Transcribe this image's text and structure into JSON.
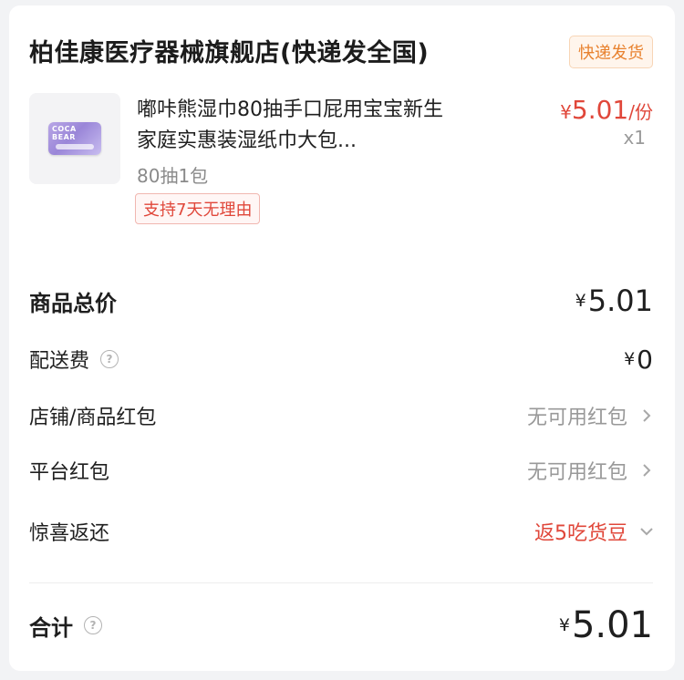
{
  "shop": {
    "name": "柏佳康医疗器械旗舰店(快递发全国)",
    "ship_tag": "快递发货"
  },
  "product": {
    "name": "嘟咔熊湿巾80抽手口屁用宝宝新生家庭实惠装湿纸巾大包...",
    "spec": "80抽1包",
    "badge": "支持7天无理由",
    "image_brand": "COCA BEAR",
    "price_symbol": "¥",
    "price": "5.01",
    "price_unit": "/份",
    "quantity": "x1"
  },
  "summary": {
    "subtotal_label": "商品总价",
    "subtotal_symbol": "¥",
    "subtotal": "5.01",
    "delivery_label": "配送费",
    "delivery_symbol": "¥",
    "delivery": "0",
    "shop_coupon_label": "店铺/商品红包",
    "shop_coupon_value": "无可用红包",
    "platform_coupon_label": "平台红包",
    "platform_coupon_value": "无可用红包",
    "surprise_label": "惊喜返还",
    "surprise_value": "返5吃货豆",
    "total_label": "合计",
    "total_symbol": "¥",
    "total": "5.01"
  },
  "colors": {
    "accent_red": "#e0473a",
    "tag_orange": "#e8822f"
  },
  "icons": {
    "help": "question-circle-icon",
    "chevron_right": "chevron-right-icon",
    "chevron_down": "chevron-down-icon"
  }
}
